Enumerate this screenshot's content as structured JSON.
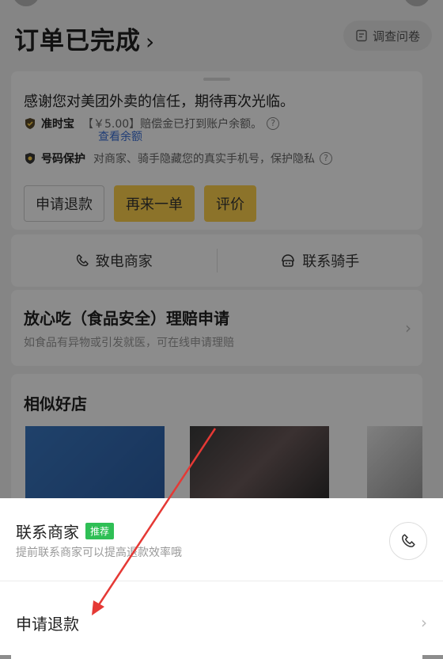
{
  "header": {
    "title": "订单已完成",
    "chevron": "›",
    "survey_label": "调查问卷"
  },
  "order_card": {
    "thanks_text": "感谢您对美团外卖的信任，期待再次光临。",
    "ontime": {
      "tag": "准时宝",
      "text": "【￥5.00】赔偿金已打到账户余额。",
      "link": "查看余额",
      "info": "?"
    },
    "privacy": {
      "tag": "号码保护",
      "text": "对商家、骑手隐藏您的真实手机号，保护隐私",
      "info": "?"
    },
    "buttons": [
      "申请退款",
      "再来一单",
      "评价"
    ]
  },
  "contact_bar": {
    "call_merchant": "致电商家",
    "contact_rider": "联系骑手"
  },
  "food_safety": {
    "title": "放心吃（食品安全）理赔申请",
    "subtitle": "如食品有异物或引发就医，可在线申请理赔",
    "chevron": "›"
  },
  "similar_shops": {
    "title": "相似好店"
  },
  "bottom_sheet": {
    "contact_merchant": {
      "title": "联系商家",
      "badge": "推荐",
      "subtitle": "提前联系商家可以提高退款效率哦"
    },
    "refund": {
      "label": "申请退款",
      "chevron": "›"
    }
  },
  "colors": {
    "accent_yellow": "#ffd24d",
    "link_blue": "#3a6fd8",
    "badge_green": "#2fbf55",
    "annotation_red": "#e53935"
  }
}
